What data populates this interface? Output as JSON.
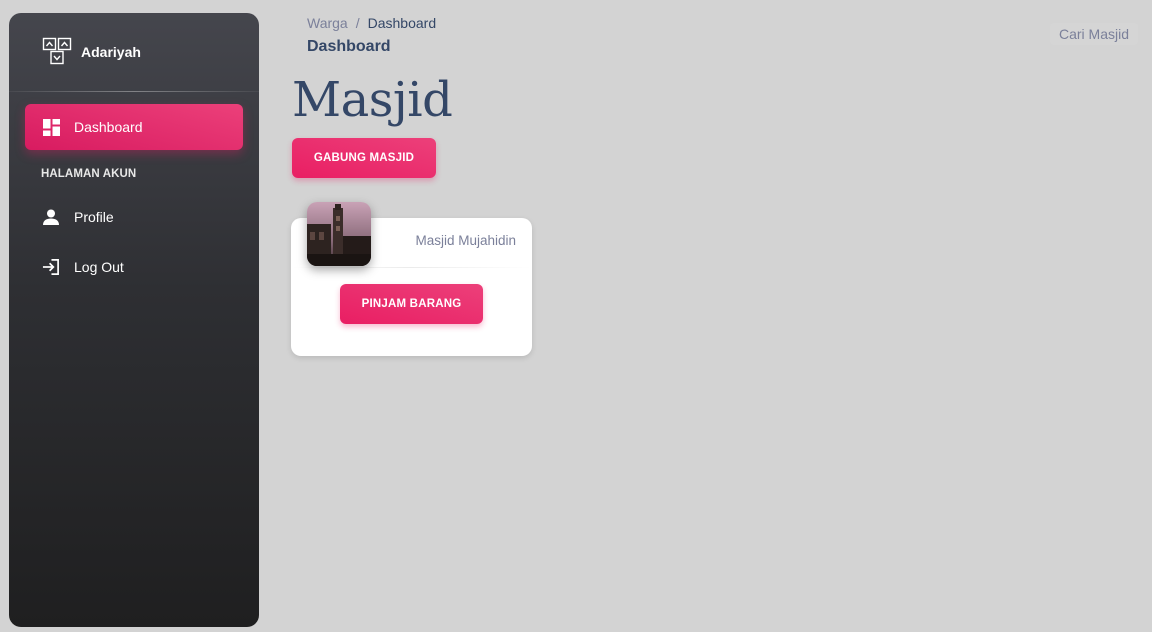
{
  "sidebar": {
    "brand": "Adariyah",
    "items": [
      {
        "label": "Dashboard",
        "icon": "dashboard-icon",
        "active": true
      }
    ],
    "section_label": "HALAMAN AKUN",
    "account_items": [
      {
        "label": "Profile",
        "icon": "person-icon"
      },
      {
        "label": "Log Out",
        "icon": "login-icon"
      }
    ]
  },
  "header": {
    "breadcrumb_root": "Warga",
    "breadcrumb_sep": "/",
    "breadcrumb_current": "Dashboard",
    "page_title": "Dashboard",
    "search_label": "Cari Masjid"
  },
  "main": {
    "heading": "Masjid",
    "join_button": "GABUNG MASJID",
    "cards": [
      {
        "name": "Masjid Mujahidin",
        "button": "PINJAM BARANG",
        "image": "mosque-photo"
      }
    ]
  },
  "colors": {
    "accent": "#e91e63",
    "text_dark": "#344767",
    "text_muted": "#7b809a",
    "background": "#d3d3d3"
  }
}
